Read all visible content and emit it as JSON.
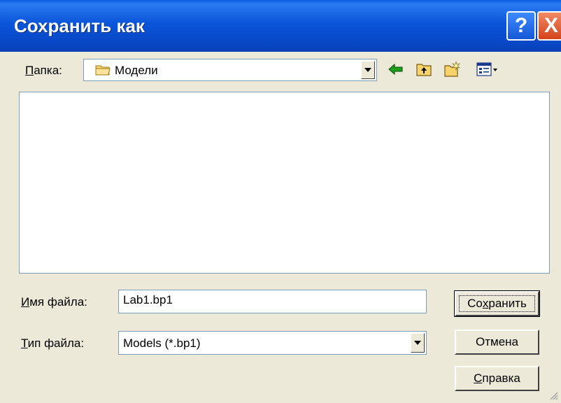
{
  "window": {
    "title": "Сохранить как"
  },
  "title_buttons": {
    "help": "?",
    "close": "X"
  },
  "folder": {
    "label_hotkey": "П",
    "label_rest": "апка:",
    "value": "Модели"
  },
  "file_name": {
    "label_hotkey": "И",
    "label_rest": "мя файла:",
    "value": "Lab1.bp1"
  },
  "file_type": {
    "label_hotkey": "Т",
    "label_rest": "ип файла:",
    "value": "Models (*.bp1)"
  },
  "buttons": {
    "save_pre": "Со",
    "save_hotkey": "х",
    "save_post": "ранить",
    "cancel": "Отмена",
    "help_hotkey": "С",
    "help_rest": "правка"
  },
  "icons": [
    "back-arrow-icon",
    "up-folder-icon",
    "new-folder-icon",
    "view-menu-icon",
    "folder-icon"
  ],
  "colors": {
    "titlebar": "#0b55d9",
    "dialog_bg": "#ece9d8",
    "close": "#d4431c"
  }
}
